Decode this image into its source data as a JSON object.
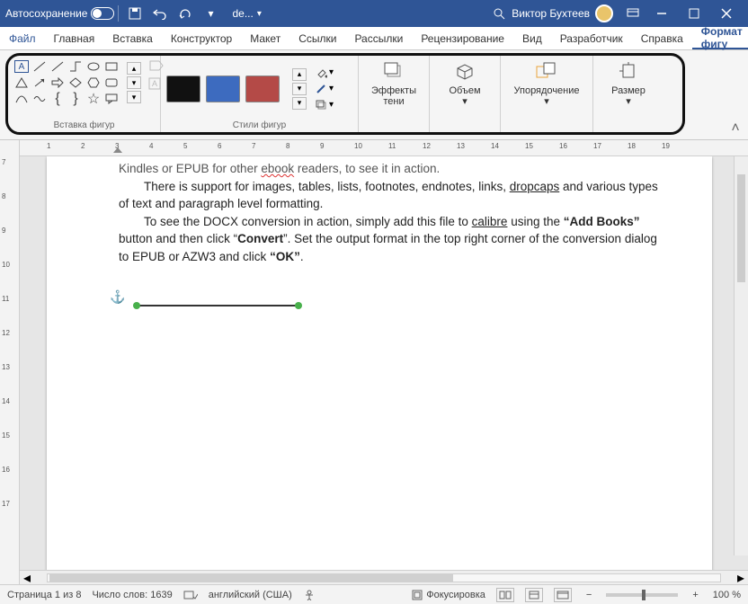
{
  "titlebar": {
    "autosave": "Автосохранение",
    "filename": "de...",
    "user": "Виктор Бухтеев"
  },
  "tabs": {
    "file": "Файл",
    "items": [
      "Главная",
      "Вставка",
      "Конструктор",
      "Макет",
      "Ссылки",
      "Рассылки",
      "Рецензирование",
      "Вид",
      "Разработчик",
      "Справка"
    ],
    "active": "Формат фигу"
  },
  "ribbon": {
    "group_insert_shapes": "Вставка фигур",
    "group_shape_styles": "Стили фигур",
    "effects": "Эффекты\nтени",
    "volume": "Объем",
    "arrange": "Упорядочение",
    "size": "Размер",
    "swatches": [
      "#111111",
      "#3d6bbf",
      "#b44a47"
    ]
  },
  "document": {
    "line0": "Kindles or EPUB for other ebook readers, to see it in action.",
    "line1a": "There is support for images, tables, lists, footnotes, endnotes, links, ",
    "line1b": "dropcaps",
    "line1c": " and various types of text and paragraph level formatting.",
    "line2a": "To see the DOCX conversion in action, simply add this file to ",
    "line2b": "calibre",
    "line2c": " using the ",
    "line2d": "“Add Books”",
    "line2e": " button and then click “",
    "line2f": "Convert",
    "line2g": "”.  Set the output format in the top right corner of the conversion dialog to EPUB or AZW3 and click ",
    "line2h": "“OK”",
    "line2i": ".",
    "spell1": "ebook"
  },
  "hruler_ticks": [
    1,
    2,
    3,
    4,
    5,
    6,
    7,
    8,
    9,
    10,
    11,
    12,
    13,
    14,
    15,
    16,
    17,
    18,
    19
  ],
  "vruler_ticks": [
    7,
    8,
    9,
    10,
    11,
    12,
    13,
    14,
    15,
    16,
    17
  ],
  "status": {
    "page": "Страница 1 из 8",
    "words": "Число слов: 1639",
    "lang": "английский (США)",
    "focus": "Фокусировка",
    "zoom_out": "−",
    "zoom_in": "+",
    "zoom": "100 %"
  }
}
